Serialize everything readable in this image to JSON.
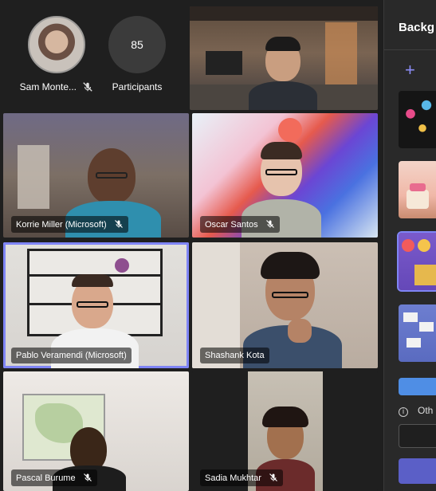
{
  "attendees_row": {
    "sam": {
      "name": "Sam Monte...",
      "muted": true
    },
    "participants": {
      "count": "85",
      "label": "Participants"
    }
  },
  "tiles": [
    {
      "name": "Korrie Miller (Microsoft)",
      "muted": true
    },
    {
      "name": "Oscar Santos",
      "muted": true
    },
    {
      "name": "Pablo Veramendi (Microsoft)",
      "muted": false,
      "selected": true
    },
    {
      "name": "Shashank Kota",
      "muted": false
    },
    {
      "name": "Pascal Burume",
      "muted": true
    },
    {
      "name": "Sadia Mukhtar",
      "muted": true
    }
  ],
  "panel": {
    "title": "Backg",
    "add_icon": "plus-icon",
    "info_text": "Oth"
  },
  "colors": {
    "accent": "#7f85f5",
    "primary_button": "#5b5fc7",
    "panel_bg": "#292929",
    "stage_bg": "#1f1f1f"
  }
}
